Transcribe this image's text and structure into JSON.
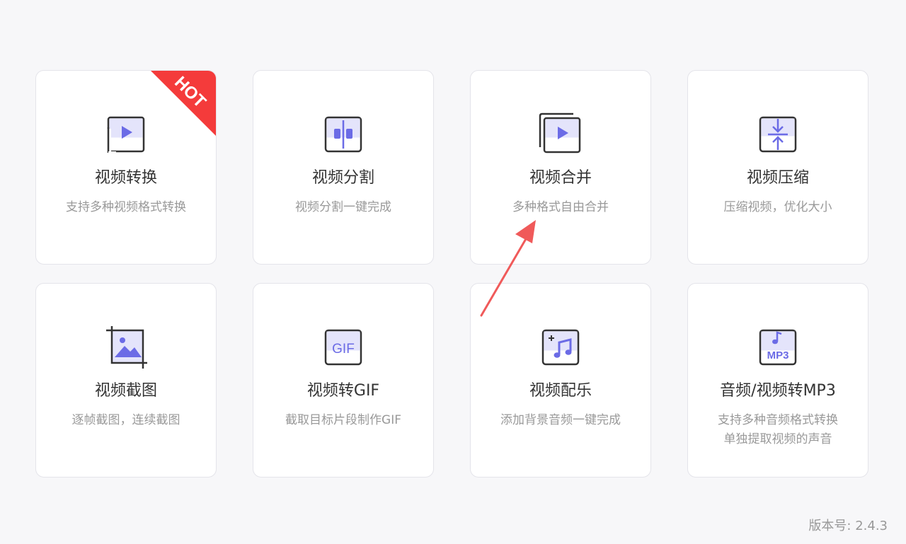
{
  "cards": [
    {
      "title": "视频转换",
      "desc": "支持多种视频格式转换",
      "icon": "video-convert-icon",
      "badge": "HOT"
    },
    {
      "title": "视频分割",
      "desc": "视频分割一键完成",
      "icon": "video-split-icon"
    },
    {
      "title": "视频合并",
      "desc": "多种格式自由合并",
      "icon": "video-merge-icon"
    },
    {
      "title": "视频压缩",
      "desc": "压缩视频，优化大小",
      "icon": "video-compress-icon"
    },
    {
      "title": "视频截图",
      "desc": "逐帧截图，连续截图",
      "icon": "video-screenshot-icon"
    },
    {
      "title": "视频转GIF",
      "desc": "截取目标片段制作GIF",
      "icon": "video-to-gif-icon",
      "icon_text": "GIF"
    },
    {
      "title": "视频配乐",
      "desc": "添加背景音频一键完成",
      "icon": "video-music-icon"
    },
    {
      "title": "音频/视频转MP3",
      "desc": "支持多种音频格式转换\n单独提取视频的声音",
      "icon": "audio-to-mp3-icon",
      "icon_text": "MP3"
    }
  ],
  "version": "版本号: 2.4.3",
  "colors": {
    "accent": "#6b6be6",
    "icon_fill": "#e4e4fb",
    "stroke": "#333333",
    "hot_badge": "#f43b3b",
    "annotation_arrow": "#f05a5a"
  }
}
